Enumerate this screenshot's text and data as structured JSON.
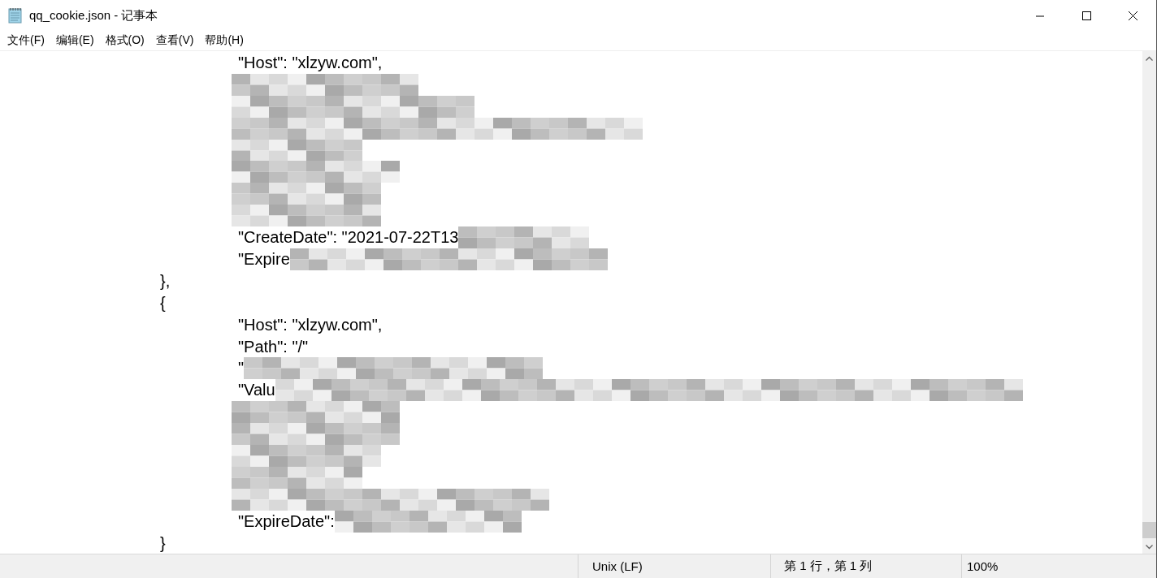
{
  "window": {
    "title": "qq_cookie.json - 记事本"
  },
  "menu": [
    {
      "label": "文件(F)"
    },
    {
      "label": "编辑(E)"
    },
    {
      "label": "格式(O)"
    },
    {
      "label": "查看(V)"
    },
    {
      "label": "帮助(H)"
    }
  ],
  "editor": {
    "lines": [
      {
        "text": "\t\t\t\"Host\": \"xlzyw.com\",",
        "redacted": false
      },
      {
        "redacted": true
      },
      {
        "redacted": true
      },
      {
        "redacted": true
      },
      {
        "redacted": true
      },
      {
        "redacted": true
      },
      {
        "redacted": true
      },
      {
        "redacted": true
      },
      {
        "text": "\t\t\t\"CreateDate\": \"2021-07-22T13",
        "redacted": true
      },
      {
        "text": "\t\t\t\"Expire",
        "redacted": true
      },
      {
        "text": "\t\t},",
        "redacted": false
      },
      {
        "text": "\t\t{",
        "redacted": false
      },
      {
        "text": "\t\t\t\"Host\": \"xlzyw.com\",",
        "redacted": false
      },
      {
        "text": "\t\t\t\"Path\": \"/\"",
        "redacted": false
      },
      {
        "text": "\t\t\t\"",
        "redacted": true
      },
      {
        "text": "\t\t\t\"Valu",
        "redacted": true
      },
      {
        "redacted": true
      },
      {
        "redacted": true
      },
      {
        "redacted": true
      },
      {
        "redacted": true
      },
      {
        "redacted": true
      },
      {
        "text": "\t\t\t\"ExpireDate\":",
        "redacted": true
      },
      {
        "text": "\t\t}",
        "redacted": false
      }
    ]
  },
  "status_bar": {
    "line_ending": "Unix (LF)",
    "position": "第 1 行，第 1 列",
    "zoom": "100%"
  }
}
